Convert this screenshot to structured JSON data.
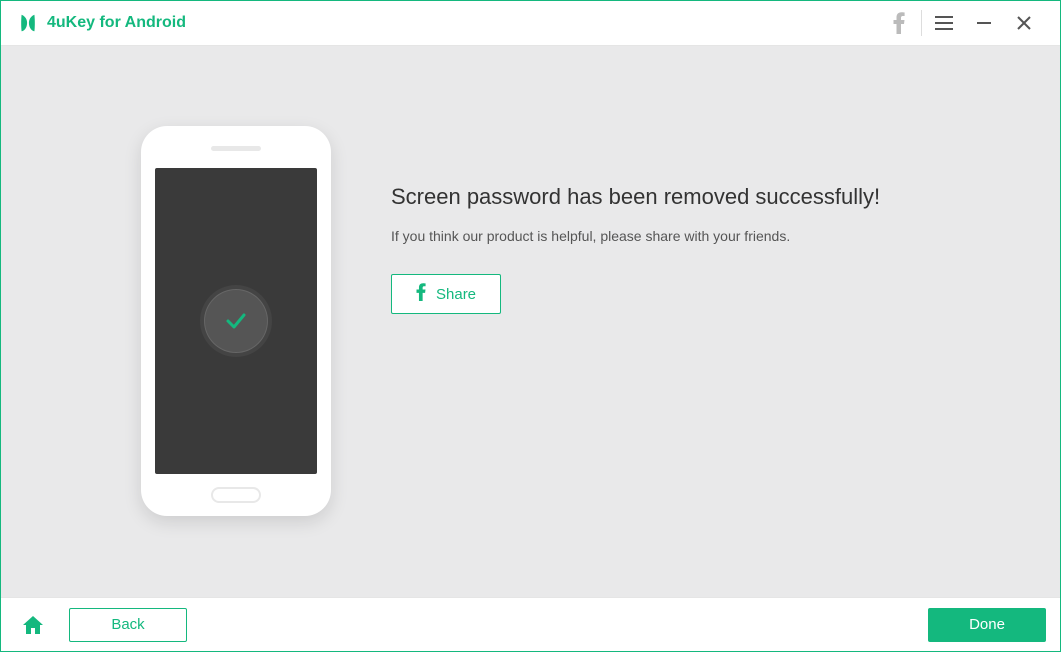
{
  "header": {
    "app_title": "4uKey for Android"
  },
  "main": {
    "heading": "Screen password has been removed successfully!",
    "subtext": "If you think our product is helpful, please share with your friends.",
    "share_label": "Share"
  },
  "footer": {
    "back_label": "Back",
    "done_label": "Done"
  },
  "colors": {
    "accent": "#14b87e"
  }
}
